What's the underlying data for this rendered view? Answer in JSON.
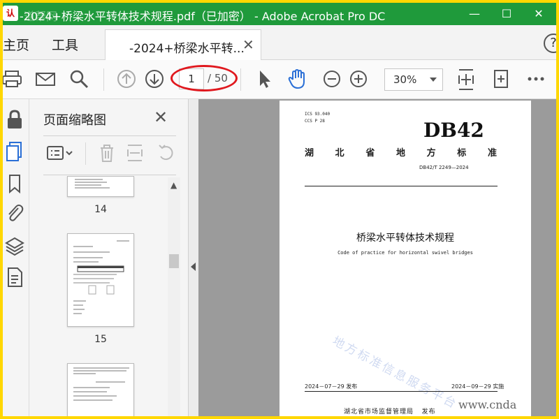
{
  "window": {
    "app_icon_text": "认",
    "title": "-2024+桥梁水平转体技术规程.pdf（已加密） - Adobe Acrobat Pro DC",
    "watermark": "道帮网",
    "minimize": "—",
    "maximize": "☐",
    "close": "✕"
  },
  "menu": {
    "home": "主页",
    "tools": "工具",
    "doc_tab_label": "-2024+桥梁水平转...",
    "doc_tab_close": "✕",
    "help": "?"
  },
  "toolbar": {
    "page_current": "1",
    "page_total": "/ 50",
    "zoom": "30%"
  },
  "thumbnail_panel": {
    "title": "页面缩略图",
    "close": "✕",
    "pages": [
      "14",
      "15"
    ]
  },
  "document": {
    "ics": "ICS 93.040",
    "ccs": "CCS P 28",
    "db": "DB42",
    "province_standard": [
      "湖",
      "北",
      "省",
      "地",
      "方",
      "标",
      "准"
    ],
    "code": "DB42/T 2249—2024",
    "title": "桥梁水平转体技术规程",
    "subtitle": "Code of practice for horizontal swivel bridges",
    "watermark": "地方标准信息服务平台",
    "publish_date": "2024－07－29 发布",
    "implement_date": "2024－09－29 实施",
    "issuer": "湖北省市场监督管理局",
    "issuer_suffix": "发布",
    "site_watermark": "www.cnda"
  },
  "colors": {
    "titlebar": "#1f9a3b",
    "frame": "#ffd700",
    "highlight_oval": "#e0181e",
    "hand_tool": "#2a6fd6"
  }
}
